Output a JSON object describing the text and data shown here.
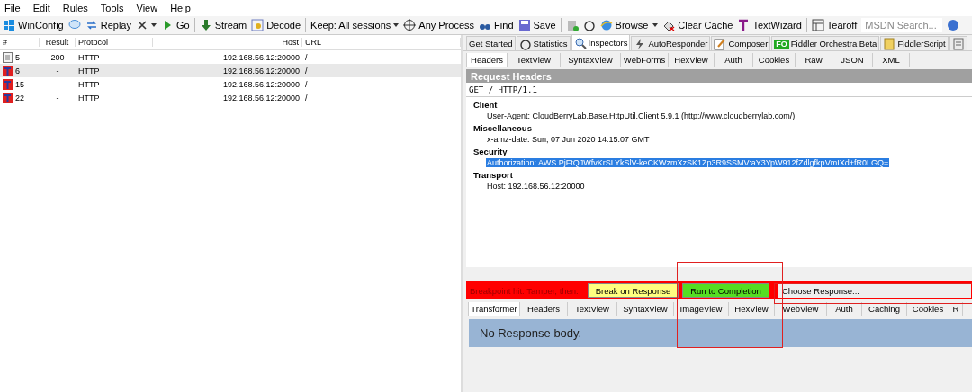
{
  "menu": [
    "File",
    "Edit",
    "Rules",
    "Tools",
    "View",
    "Help"
  ],
  "toolbar": [
    {
      "kind": "button",
      "label": "WinConfig"
    },
    {
      "kind": "button"
    },
    {
      "kind": "button",
      "label": "Replay"
    },
    {
      "kind": "caret"
    },
    {
      "kind": "button",
      "label": "Go"
    },
    {
      "kind": "separator"
    },
    {
      "kind": "button",
      "label": "Stream"
    },
    {
      "kind": "button",
      "label": "Decode"
    },
    {
      "kind": "separator"
    },
    {
      "kind": "dropdown",
      "label": "Keep: All sessions"
    },
    {
      "kind": "button",
      "label": "Any Process"
    },
    {
      "kind": "button",
      "label": "Find"
    },
    {
      "kind": "button",
      "label": "Save"
    },
    {
      "kind": "separator"
    },
    {
      "kind": "button"
    },
    {
      "kind": "button"
    },
    {
      "kind": "button",
      "label": "Browse"
    },
    {
      "kind": "caret"
    },
    {
      "kind": "button",
      "label": "Clear Cache"
    },
    {
      "kind": "button",
      "label": "TextWizard"
    },
    {
      "kind": "separator"
    },
    {
      "kind": "button",
      "label": "Tearoff"
    },
    {
      "kind": "search",
      "placeholder": "MSDN Search..."
    },
    {
      "kind": "button"
    }
  ],
  "sessions": {
    "columns": [
      "#",
      "Result",
      "Protocol",
      "Host",
      "URL"
    ],
    "rows": [
      {
        "kind": "done",
        "id": "5",
        "result": "200",
        "protocol": "HTTP",
        "host": "192.168.56.12:20000",
        "url": "/",
        "selected": false
      },
      {
        "kind": "breakpoint",
        "id": "6",
        "result": "-",
        "protocol": "HTTP",
        "host": "192.168.56.12:20000",
        "url": "/",
        "selected": true
      },
      {
        "kind": "breakpoint",
        "id": "15",
        "result": "-",
        "protocol": "HTTP",
        "host": "192.168.56.12:20000",
        "url": "/",
        "selected": false
      },
      {
        "kind": "breakpoint",
        "id": "22",
        "result": "-",
        "protocol": "HTTP",
        "host": "192.168.56.12:20000",
        "url": "/",
        "selected": false
      }
    ]
  },
  "main_tabs": [
    {
      "label": "Get Started",
      "selected": false
    },
    {
      "label": "Statistics",
      "selected": false
    },
    {
      "label": "Inspectors",
      "selected": true
    },
    {
      "label": "AutoResponder",
      "selected": false
    },
    {
      "label": "Composer",
      "selected": false
    },
    {
      "label": "Fiddler Orchestra Beta",
      "badge": "FO",
      "selected": false
    },
    {
      "label": "FiddlerScript",
      "selected": false
    },
    {
      "selected": false
    }
  ],
  "request_tabs": [
    {
      "label": "Headers",
      "selected": true
    },
    {
      "label": "TextView",
      "selected": false
    },
    {
      "label": "SyntaxView",
      "selected": false
    },
    {
      "label": "WebForms",
      "selected": false
    },
    {
      "label": "HexView",
      "selected": false
    },
    {
      "label": "Auth",
      "selected": false
    },
    {
      "label": "Cookies",
      "selected": false
    },
    {
      "label": "Raw",
      "selected": false
    },
    {
      "label": "JSON",
      "selected": false
    },
    {
      "label": "XML",
      "selected": false
    }
  ],
  "request_headers": {
    "title": "Request Headers",
    "request_line": "GET / HTTP/1.1",
    "groups": [
      {
        "name": "Client",
        "headers": [
          {
            "text": "User-Agent: CloudBerryLab.Base.HttpUtil.Client 5.9.1 (http://www.cloudberrylab.com/)",
            "selected": false
          }
        ]
      },
      {
        "name": "Miscellaneous",
        "headers": [
          {
            "text": "x-amz-date: Sun, 07 Jun 2020 14:15:07 GMT",
            "selected": false
          }
        ]
      },
      {
        "name": "Security",
        "headers": [
          {
            "text": "Authorization: AWS PjFtQJWfvKrSLYkSlV-keCKWzmXzSK1Zp3R9SSMV:aY3YpW912fZdlgfkpVmIXd+fR0LGQ=",
            "selected": true
          }
        ]
      },
      {
        "name": "Transport",
        "headers": [
          {
            "text": "Host: 192.168.56.12:20000",
            "selected": false
          }
        ]
      }
    ]
  },
  "breakpoint_bar": {
    "message": "Breakpoint hit. Tamper, then:",
    "buttons": [
      {
        "label": "Break on Response",
        "color": "#ffff80"
      },
      {
        "label": "Run to Completion",
        "color": "#55dd22"
      }
    ],
    "choose": "Choose Response..."
  },
  "response_tabs": [
    {
      "label": "Transformer",
      "selected": true
    },
    {
      "label": "Headers",
      "selected": false
    },
    {
      "label": "TextView",
      "selected": false
    },
    {
      "label": "SyntaxView",
      "selected": false
    },
    {
      "label": "ImageView",
      "selected": false
    },
    {
      "label": "HexView",
      "selected": false
    },
    {
      "label": "WebView",
      "selected": false
    },
    {
      "label": "Auth",
      "selected": false
    },
    {
      "label": "Caching",
      "selected": false
    },
    {
      "label": "Cookies",
      "selected": false
    },
    {
      "label": "R",
      "selected": false
    }
  ],
  "response_body": "No Response body."
}
